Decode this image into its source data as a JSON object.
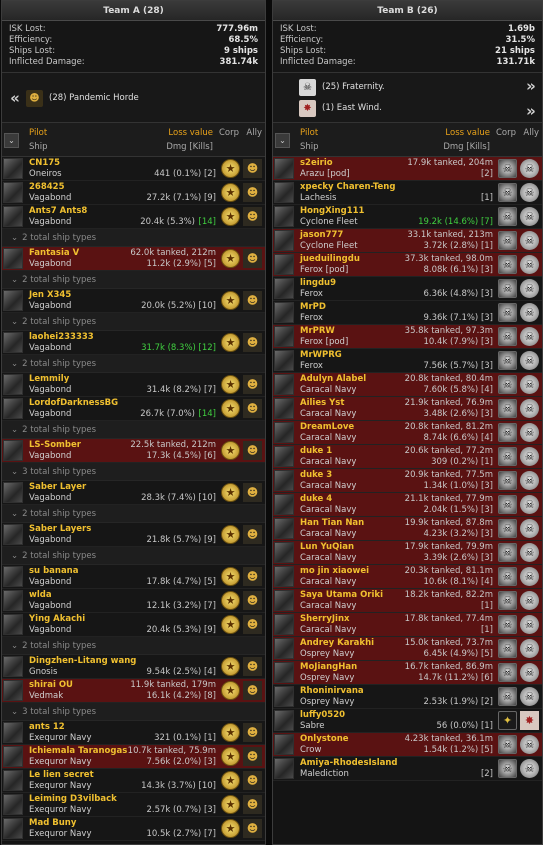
{
  "teamA": {
    "title": "Team A (28)",
    "stats": [
      {
        "label": "ISK Lost:",
        "value": "777.96m"
      },
      {
        "label": "Efficiency:",
        "value": "68.5%"
      },
      {
        "label": "Ships Lost:",
        "value": "9 ships"
      },
      {
        "label": "Inflicted Damage:",
        "value": "381.74k"
      }
    ],
    "alliances": [
      {
        "text": "(28)  Pandemic Horde"
      }
    ]
  },
  "teamB": {
    "title": "Team B (26)",
    "stats": [
      {
        "label": "ISK Lost:",
        "value": "1.69b"
      },
      {
        "label": "Efficiency:",
        "value": "31.5%"
      },
      {
        "label": "Ships Lost:",
        "value": "21 ships"
      },
      {
        "label": "Inflicted Damage:",
        "value": "131.71k"
      }
    ],
    "alliances": [
      {
        "text": "(25)  Fraternity."
      },
      {
        "text": "(1)  East Wind."
      }
    ]
  },
  "header": {
    "pilot": "Pilot",
    "ship": "Ship",
    "loss": "Loss value",
    "dmg": "Dmg [Kills]",
    "corp": "Corp",
    "ally": "Ally"
  },
  "nav": {
    "prev": "«",
    "next": "»"
  },
  "rowsA": [
    {
      "t": "row",
      "pilot": "CN175",
      "ship": "Oneiros",
      "tank": "",
      "dmg": "441 (0.1%) [2]"
    },
    {
      "t": "row",
      "pilot": "268425",
      "ship": "Vagabond",
      "tank": "",
      "dmg": "27.2k (7.1%) [9]"
    },
    {
      "t": "row",
      "pilot": "Ants7 Ants8",
      "ship": "Vagabond",
      "tank": "",
      "dmg": "20.4k (5.3%)",
      "kills": "[14]"
    },
    {
      "t": "sub",
      "text": "2 total ship types"
    },
    {
      "t": "row",
      "red": true,
      "pilot": "Fantasia V",
      "ship": "Vagabond",
      "tank": "62.0k tanked, 212m",
      "dmg": "11.2k (2.9%) [5]"
    },
    {
      "t": "sub",
      "text": "2 total ship types"
    },
    {
      "t": "row",
      "pilot": "Jen X345",
      "ship": "Vagabond",
      "tank": "",
      "dmg": "20.0k (5.2%) [10]"
    },
    {
      "t": "sub",
      "text": "2 total ship types"
    },
    {
      "t": "row",
      "pilot": "laohei233333",
      "ship": "Vagabond",
      "tank": "",
      "dmg": "31.7k (8.3%) [12]",
      "green": true
    },
    {
      "t": "sub",
      "text": "2 total ship types"
    },
    {
      "t": "row",
      "pilot": "Lemmily",
      "ship": "Vagabond",
      "tank": "",
      "dmg": "31.4k (8.2%) [7]"
    },
    {
      "t": "row",
      "pilot": "LordofDarknessBG",
      "ship": "Vagabond",
      "tank": "",
      "dmg": "26.7k (7.0%)",
      "kills": "[14]"
    },
    {
      "t": "sub",
      "text": "2 total ship types"
    },
    {
      "t": "row",
      "red": true,
      "pilot": "LS-Somber",
      "ship": "Vagabond",
      "tank": "22.5k tanked, 212m",
      "dmg": "17.3k (4.5%) [6]"
    },
    {
      "t": "sub",
      "text": "3 total ship types"
    },
    {
      "t": "row",
      "pilot": "Saber Layer",
      "ship": "Vagabond",
      "tank": "",
      "dmg": "28.3k (7.4%) [10]"
    },
    {
      "t": "sub",
      "text": "2 total ship types"
    },
    {
      "t": "row",
      "pilot": "Saber Layers",
      "ship": "Vagabond",
      "tank": "",
      "dmg": "21.8k (5.7%) [9]"
    },
    {
      "t": "sub",
      "text": "2 total ship types"
    },
    {
      "t": "row",
      "pilot": "su banana",
      "ship": "Vagabond",
      "tank": "",
      "dmg": "17.8k (4.7%) [5]"
    },
    {
      "t": "row",
      "pilot": "wlda",
      "ship": "Vagabond",
      "tank": "",
      "dmg": "12.1k (3.2%) [7]"
    },
    {
      "t": "row",
      "pilot": "Ying Akachi",
      "ship": "Vagabond",
      "tank": "",
      "dmg": "20.4k (5.3%) [9]"
    },
    {
      "t": "sub",
      "text": "2 total ship types"
    },
    {
      "t": "row",
      "pilot": "Dingzhen-Litang wang",
      "ship": "Gnosis",
      "tank": "",
      "dmg": "9.54k (2.5%) [4]"
    },
    {
      "t": "row",
      "red": true,
      "pilot": "shirai OU",
      "ship": "Vedmak",
      "tank": "11.9k tanked, 179m",
      "dmg": "16.1k (4.2%) [8]"
    },
    {
      "t": "sub",
      "text": "3 total ship types"
    },
    {
      "t": "row",
      "pilot": "ants 12",
      "ship": "Exequror Navy",
      "tank": "",
      "dmg": "321 (0.1%) [1]"
    },
    {
      "t": "row",
      "red": true,
      "pilot": "Ichiemala Taranogas",
      "ship": "Exequror Navy",
      "tank": "10.7k tanked, 75.9m",
      "dmg": "7.56k (2.0%) [3]"
    },
    {
      "t": "row",
      "pilot": "Le lien secret",
      "ship": "Exequror Navy",
      "tank": "",
      "dmg": "14.3k (3.7%) [10]"
    },
    {
      "t": "row",
      "pilot": "Leiming D3vilback",
      "ship": "Exequror Navy",
      "tank": "",
      "dmg": "2.57k (0.7%) [3]"
    },
    {
      "t": "row",
      "pilot": "Mad Buny",
      "ship": "Exequror Navy",
      "tank": "",
      "dmg": "10.5k (2.7%) [7]"
    }
  ],
  "rowsB": [
    {
      "red": true,
      "pilot": "s2eirio",
      "ship": "Arazu [pod]",
      "tank": "17.9k tanked, 204m",
      "dmg": "[2]"
    },
    {
      "pilot": "xpecky Charen-Teng",
      "ship": "Lachesis",
      "tank": "",
      "dmg": "[1]"
    },
    {
      "pilot": "HongXing111",
      "ship": "Cyclone Fleet",
      "tank": "",
      "dmg": "19.2k (14.6%) [7]",
      "green": true
    },
    {
      "red": true,
      "pilot": "jason777",
      "ship": "Cyclone Fleet",
      "tank": "33.1k tanked, 213m",
      "dmg": "3.72k (2.8%) [1]"
    },
    {
      "red": true,
      "pilot": "jueduilingdu",
      "ship": "Ferox [pod]",
      "tank": "37.3k tanked, 98.0m",
      "dmg": "8.08k (6.1%) [3]"
    },
    {
      "pilot": "lingdu9",
      "ship": "Ferox",
      "tank": "",
      "dmg": "6.36k (4.8%) [3]"
    },
    {
      "pilot": "MrPD",
      "ship": "Ferox",
      "tank": "",
      "dmg": "9.36k (7.1%) [3]"
    },
    {
      "red": true,
      "pilot": "MrPRW",
      "ship": "Ferox [pod]",
      "tank": "35.8k tanked, 97.3m",
      "dmg": "10.4k (7.9%) [3]"
    },
    {
      "pilot": "MrWPRG",
      "ship": "Ferox",
      "tank": "",
      "dmg": "7.56k (5.7%) [3]"
    },
    {
      "red": true,
      "pilot": "Adulyn Alabel",
      "ship": "Caracal Navy",
      "tank": "20.8k tanked, 80.4m",
      "dmg": "7.60k (5.8%) [4]"
    },
    {
      "red": true,
      "pilot": "Ailies Yst",
      "ship": "Caracal Navy",
      "tank": "21.9k tanked, 76.9m",
      "dmg": "3.48k (2.6%) [3]"
    },
    {
      "red": true,
      "pilot": "DreamLove",
      "ship": "Caracal Navy",
      "tank": "20.8k tanked, 81.2m",
      "dmg": "8.74k (6.6%) [4]"
    },
    {
      "red": true,
      "pilot": "duke 1",
      "ship": "Caracal Navy",
      "tank": "20.6k tanked, 77.2m",
      "dmg": "309 (0.2%) [1]"
    },
    {
      "red": true,
      "pilot": "duke 3",
      "ship": "Caracal Navy",
      "tank": "20.9k tanked, 77.5m",
      "dmg": "1.34k (1.0%) [3]"
    },
    {
      "red": true,
      "pilot": "duke 4",
      "ship": "Caracal Navy",
      "tank": "21.1k tanked, 77.9m",
      "dmg": "2.04k (1.5%) [3]"
    },
    {
      "red": true,
      "pilot": "Han Tian Nan",
      "ship": "Caracal Navy",
      "tank": "19.9k tanked, 87.8m",
      "dmg": "4.23k (3.2%) [3]"
    },
    {
      "red": true,
      "pilot": "Lun YuQian",
      "ship": "Caracal Navy",
      "tank": "17.9k tanked, 79.9m",
      "dmg": "3.39k (2.6%) [3]"
    },
    {
      "red": true,
      "pilot": "mo jin xiaowei",
      "ship": "Caracal Navy",
      "tank": "20.3k tanked, 81.1m",
      "dmg": "10.6k (8.1%) [4]"
    },
    {
      "red": true,
      "pilot": "Saya Utama Oriki",
      "ship": "Caracal Navy",
      "tank": "18.2k tanked, 82.2m",
      "dmg": "[1]"
    },
    {
      "red": true,
      "pilot": "SherryJinx",
      "ship": "Caracal Navy",
      "tank": "17.8k tanked, 77.4m",
      "dmg": "[1]"
    },
    {
      "red": true,
      "pilot": "Andrey Karakhi",
      "ship": "Osprey Navy",
      "tank": "15.0k tanked, 73.7m",
      "dmg": "6.45k (4.9%) [5]"
    },
    {
      "red": true,
      "pilot": "MoJiangHan",
      "ship": "Osprey Navy",
      "tank": "16.7k tanked, 86.9m",
      "dmg": "14.7k (11.2%) [6]"
    },
    {
      "pilot": "Rhoninirvana",
      "ship": "Osprey Navy",
      "tank": "",
      "dmg": "2.53k (1.9%) [2]"
    },
    {
      "pilot": "luffy0520",
      "ship": "Sabre",
      "tank": "",
      "dmg": "56 (0.0%) [1]",
      "altIcons": true
    },
    {
      "red": true,
      "pilot": "Onlystone",
      "ship": "Crow",
      "tank": "4.23k tanked, 36.1m",
      "dmg": "1.54k (1.2%) [5]"
    },
    {
      "pilot": "Amiya-RhodesIsland",
      "ship": "Malediction",
      "tank": "",
      "dmg": "[2]"
    }
  ]
}
